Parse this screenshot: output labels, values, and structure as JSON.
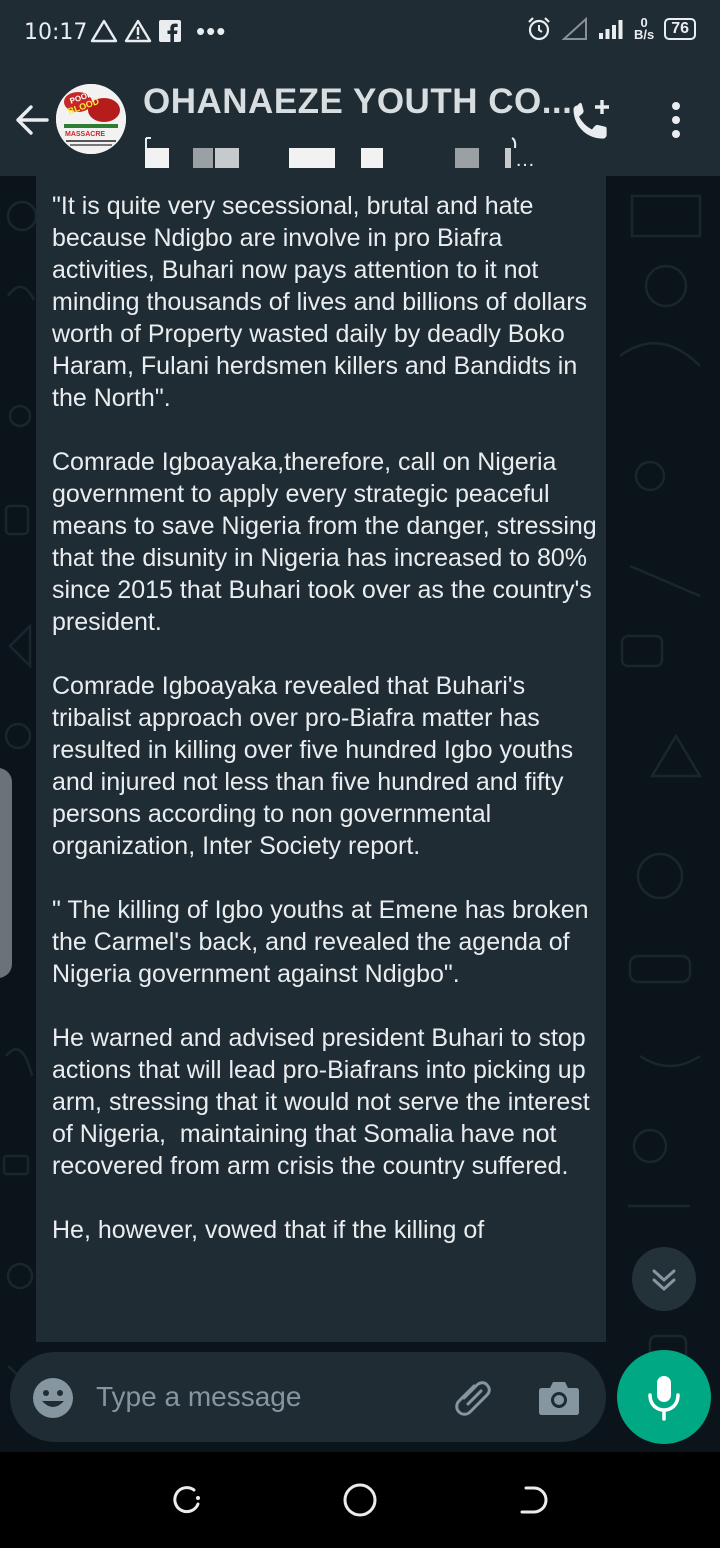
{
  "status_bar": {
    "time": "10:17",
    "net_speed_value": "0",
    "net_speed_unit": "B/s",
    "battery": "76"
  },
  "header": {
    "title": "OHANAEZE YOUTH CO...",
    "avatar_text": {
      "line1": "POOL",
      "line2": "BLOOD",
      "line3": "MASSACRE"
    },
    "icons": [
      "back-arrow-icon",
      "add-call-icon",
      "more-vert-icon"
    ]
  },
  "message": {
    "text": "\"It is quite very secessional, brutal and hate because Ndigbo are involve in pro Biafra activities, Buhari now pays attention to it not minding thousands of lives and billions of dollars worth of Property wasted daily by deadly Boko Haram, Fulani herdsmen killers and Bandidts in the North\".\n\nComrade Igboayaka,therefore, call on Nigeria government to apply every strategic peaceful means to save Nigeria from the danger, stressing that the disunity in Nigeria has increased to 80% since 2015 that Buhari took over as the country's president.\n\nComrade Igboayaka revealed that Buhari's tribalist approach over pro-Biafra matter has resulted in killing over five hundred Igbo youths and injured not less than five hundred and fifty persons according to non governmental organization, Inter Society report.\n\n\" The killing of Igbo youths at Emene has broken the Carmel's back, and revealed the agenda of Nigeria government against Ndigbo\".\n\nHe warned and advised president Buhari to stop actions that will lead pro-Biafrans into picking up arm, stressing that it would not serve the interest of Nigeria,  maintaining that Somalia have not recovered from arm crisis the country suffered.\n\nHe, however, vowed that if the killing of"
  },
  "composer": {
    "placeholder": "Type a message",
    "icons": [
      "emoji-icon",
      "attach-icon",
      "camera-icon",
      "mic-icon"
    ]
  },
  "colors": {
    "accent": "#00a884",
    "header_bg": "#1f2c34",
    "bubble_bg": "#1f2c33",
    "chat_bg": "#0b141a",
    "text": "#e9edef",
    "muted": "#8696a0"
  }
}
